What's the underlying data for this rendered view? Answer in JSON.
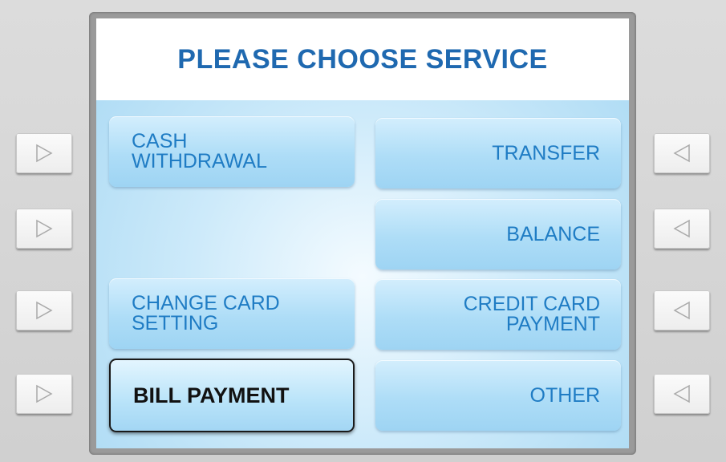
{
  "screen": {
    "title": "PLEASE CHOOSE SERVICE"
  },
  "options": {
    "left": [
      {
        "label": "CASH\nWITHDRAWAL"
      },
      {
        "label": ""
      },
      {
        "label": "CHANGE CARD\nSETTING"
      },
      {
        "label": "BILL PAYMENT",
        "selected": true
      }
    ],
    "right": [
      {
        "label": "TRANSFER"
      },
      {
        "label": "BALANCE"
      },
      {
        "label": "CREDIT CARD\nPAYMENT"
      },
      {
        "label": "OTHER"
      }
    ]
  },
  "side_keys": {
    "left_icon": "triangle-right-icon",
    "right_icon": "triangle-left-icon"
  },
  "colors": {
    "title": "#1f69b0",
    "option_text": "#1f7cc4",
    "selected_text": "#111111",
    "selected_border": "#1a1a1a"
  }
}
